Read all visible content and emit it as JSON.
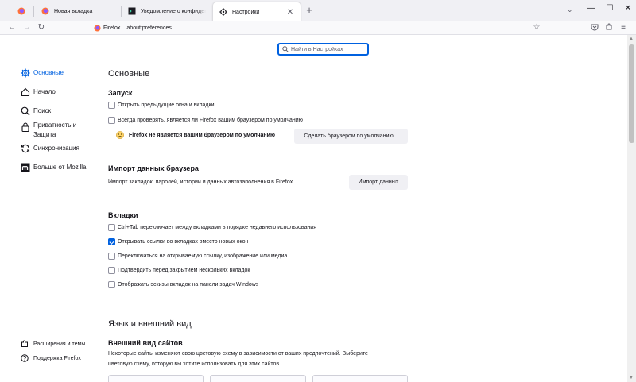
{
  "tabs": [
    {
      "title": "Новая вкладка"
    },
    {
      "title": "Уведомление о конфиденциальности"
    },
    {
      "title": "Настройки"
    }
  ],
  "urlbar": {
    "identity": "Firefox",
    "url": "about:preferences"
  },
  "search": {
    "placeholder": "Найти в Настройках"
  },
  "sidebar": {
    "categories": [
      {
        "label": "Основные"
      },
      {
        "label": "Начало"
      },
      {
        "label": "Поиск"
      },
      {
        "label": "Приватность и Защита"
      },
      {
        "label": "Синхронизация"
      },
      {
        "label": "Больше от Mozilla"
      }
    ],
    "footer": [
      {
        "label": "Расширения и темы"
      },
      {
        "label": "Поддержка Firefox"
      }
    ]
  },
  "main": {
    "title": "Основные",
    "startup": {
      "heading": "Запуск",
      "restore_session": "Открыть предыдущие окна и вкладки",
      "check_default": "Всегда проверять, является ли Firefox вашим браузером по умолчанию",
      "not_default_msg": "Firefox не является вашим браузером по умолчанию",
      "make_default_button": "Сделать браузером по умолчанию..."
    },
    "import": {
      "heading": "Импорт данных браузера",
      "description": "Импорт закладок, паролей, истории и данных автозаполнения в Firefox.",
      "button": "Импорт данных"
    },
    "tabs_section": {
      "heading": "Вкладки",
      "options": [
        {
          "label": "Ctrl+Tab переключает между вкладками в порядке недавнего использования",
          "checked": false
        },
        {
          "label": "Открывать ссылки во вкладках вместо новых окон",
          "checked": true
        },
        {
          "label": "Переключаться на открываемую ссылку, изображение или медиа",
          "checked": false
        },
        {
          "label": "Подтвердить перед закрытием нескольких вкладок",
          "checked": false
        },
        {
          "label": "Отображать эскизы вкладок на панели задач Windows",
          "checked": false
        }
      ]
    },
    "language": {
      "title": "Язык и внешний вид",
      "appearance_heading": "Внешний вид сайтов",
      "appearance_desc_1": "Некоторые сайты изменяют свою цветовую схему в зависимости от ваших предпочтений. Выберите",
      "appearance_desc_2": "цветовую схему, которую вы хотите использовать для этих сайтов."
    }
  },
  "colors": {
    "accent": "#0061e0",
    "firefox_orange": "#ff7139",
    "firefox_purple": "#9059ff"
  }
}
